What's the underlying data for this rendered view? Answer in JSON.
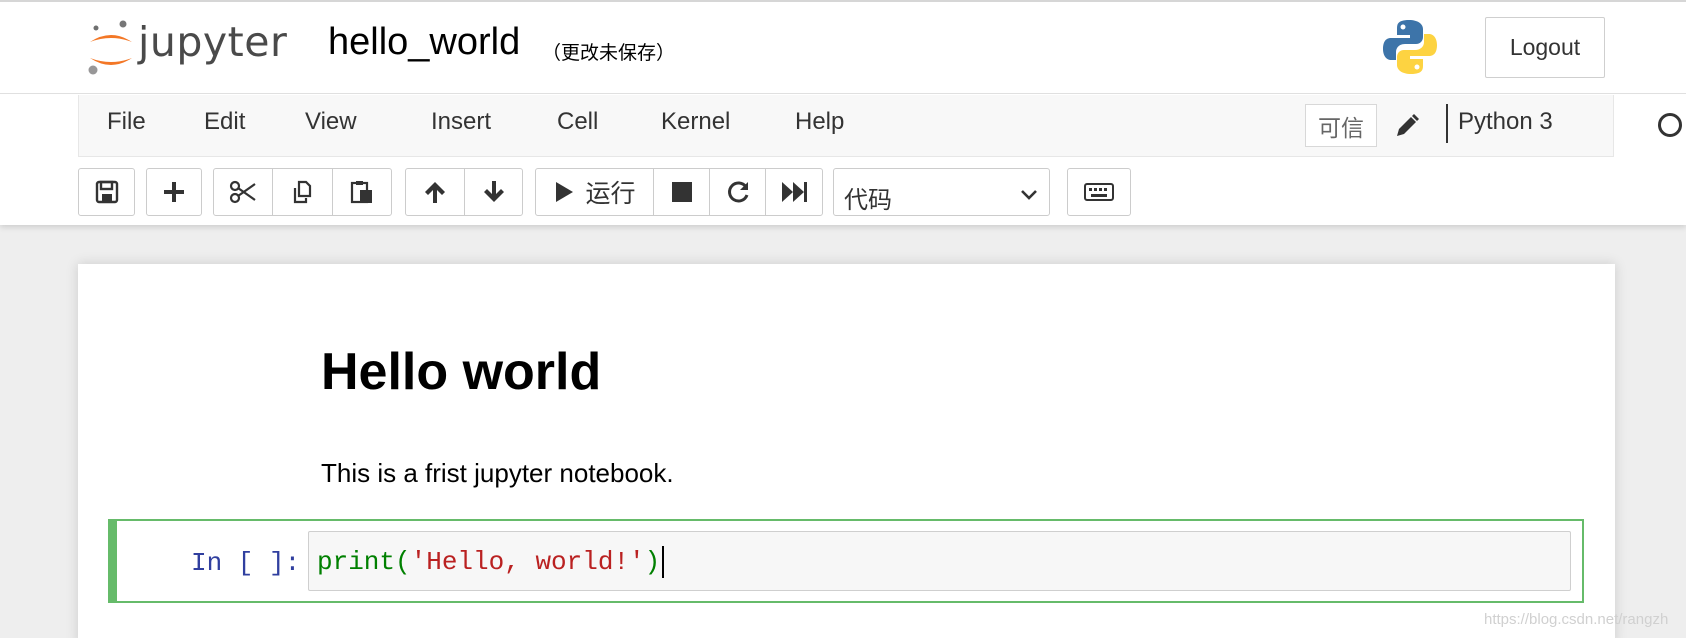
{
  "header": {
    "logo_text": "jupyter",
    "notebook_name": "hello_world",
    "save_status": "（更改未保存）",
    "logout_label": "Logout"
  },
  "menubar": {
    "items": [
      "File",
      "Edit",
      "View",
      "Insert",
      "Cell",
      "Kernel",
      "Help"
    ],
    "trusted_label": "可信",
    "kernel_name": "Python 3"
  },
  "toolbar": {
    "buttons": [
      "save-icon",
      "plus-icon",
      "cut-icon",
      "copy-icon",
      "paste-icon",
      "arrow-up-icon",
      "arrow-down-icon",
      "play-icon",
      "stop-icon",
      "restart-icon",
      "fast-forward-icon",
      "keyboard-icon"
    ],
    "run_label": "运行",
    "cell_type": "代码"
  },
  "notebook": {
    "markdown_title": "Hello world",
    "markdown_text": "This is a frist jupyter notebook.",
    "code_prompt": "In [ ]:",
    "code": {
      "func": "print",
      "open_paren": "(",
      "string": "'Hello, world!'",
      "close_paren": ")"
    }
  },
  "watermark": "https://blog.csdn.net/rangzh",
  "colors": {
    "accent_green": "#66bb6a",
    "prompt_blue": "#303f9f",
    "string_red": "#ba2121",
    "builtin_green": "#008000",
    "logo_orange": "#f37726"
  }
}
